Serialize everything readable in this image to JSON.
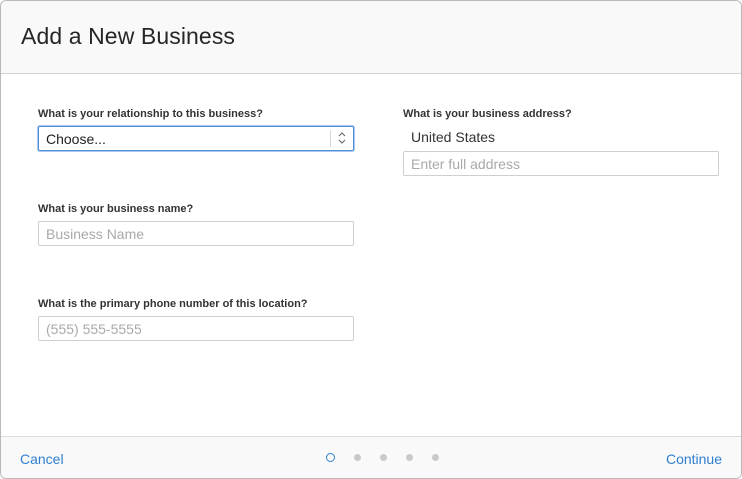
{
  "dialog": {
    "title": "Add a New Business"
  },
  "form": {
    "relationship": {
      "label": "What is your relationship to this business?",
      "selected": "Choose..."
    },
    "business_name": {
      "label": "What is your business name?",
      "placeholder": "Business Name",
      "value": ""
    },
    "phone": {
      "label": "What is the primary phone number of this location?",
      "placeholder": "(555) 555-5555",
      "value": ""
    },
    "address": {
      "label": "What is your business address?",
      "country": "United States",
      "placeholder": "Enter full address",
      "value": ""
    }
  },
  "footer": {
    "cancel_label": "Cancel",
    "continue_label": "Continue",
    "steps_total": 5,
    "current_step": 1
  },
  "colors": {
    "accent": "#2f80d1",
    "focus_border": "#4a90d9",
    "header_bg": "#f9f9f9",
    "inactive_dot": "#c9c9c9"
  }
}
